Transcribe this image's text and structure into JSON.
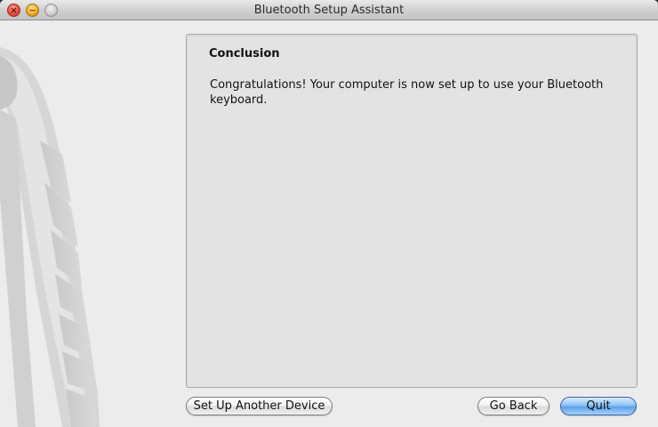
{
  "window": {
    "title": "Bluetooth Setup Assistant"
  },
  "titlebar": {
    "close_icon": "close-icon",
    "minimize_icon": "minimize-icon",
    "zoom_icon": "zoom-icon"
  },
  "panel": {
    "heading": "Conclusion",
    "body": "Congratulations! Your computer is now set up to use your Bluetooth keyboard."
  },
  "buttons": {
    "setup_another": "Set Up Another Device",
    "go_back": "Go Back",
    "quit": "Quit"
  },
  "colors": {
    "window_bg": "#ececec",
    "panel_bg": "#e3e3e3",
    "default_button": "#5ea0e6"
  }
}
